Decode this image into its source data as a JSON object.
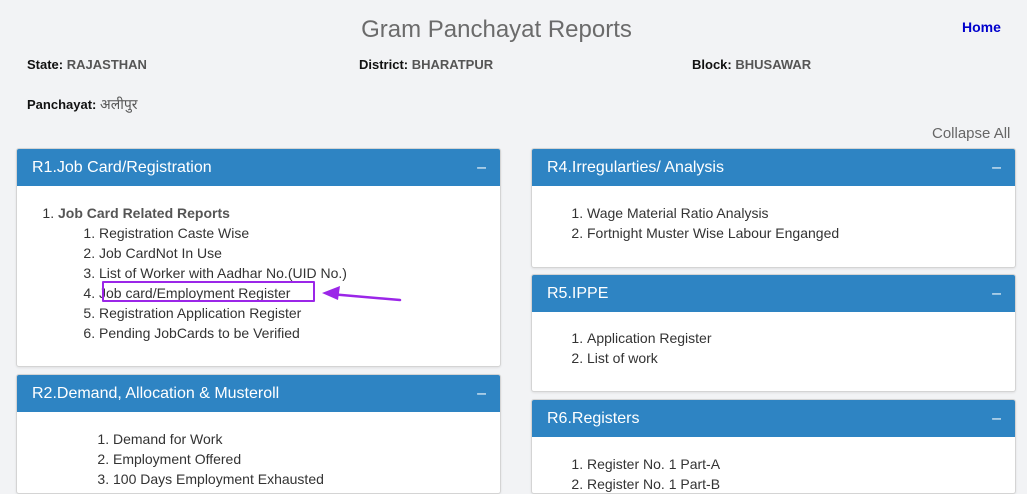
{
  "header": {
    "title": "Gram Panchayat Reports",
    "home_label": "Home"
  },
  "location": {
    "state_label": "State:",
    "state_value": "RAJASTHAN",
    "district_label": "District:",
    "district_value": "BHARATPUR",
    "block_label": "Block:",
    "block_value": "BHUSAWAR",
    "panchayat_label": "Panchayat:",
    "panchayat_value": "अलीपुर"
  },
  "collapse_all_label": "Collapse All",
  "collapse_symbol": "–",
  "panels": {
    "r1": {
      "title": "R1.Job Card/Registration",
      "group": "Job Card Related Reports",
      "items": [
        "Registration Caste Wise",
        "Job CardNot In Use",
        "List of Worker with Aadhar No.(UID No.)",
        "Job card/Employment Register",
        "Registration Application Register",
        "Pending JobCards to be Verified"
      ]
    },
    "r2": {
      "title": "R2.Demand, Allocation & Musteroll",
      "items": [
        "Demand for Work",
        "Employment Offered",
        "100 Days Employment Exhausted"
      ]
    },
    "r4": {
      "title": "R4.Irregularties/ Analysis",
      "items": [
        "Wage Material Ratio Analysis",
        "Fortnight Muster Wise Labour Enganged"
      ]
    },
    "r5": {
      "title": "R5.IPPE",
      "items": [
        "Application Register",
        "List of work"
      ]
    },
    "r6": {
      "title": "R6.Registers",
      "items": [
        "Register No. 1 Part-A",
        "Register No. 1 Part-B"
      ]
    }
  },
  "annotation": {
    "color": "#9b26e8"
  }
}
